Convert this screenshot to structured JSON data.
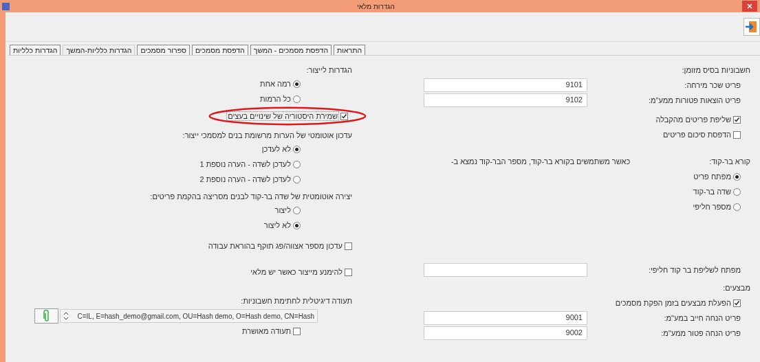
{
  "window": {
    "title": "הגדרות מלאי"
  },
  "tabs": [
    {
      "label": "התראות",
      "selected": false
    },
    {
      "label": "הדפסת מסמכים - המשך",
      "selected": false
    },
    {
      "label": "הדפסת מסמכים",
      "selected": false
    },
    {
      "label": "ספרור מסמכים",
      "selected": false
    },
    {
      "label": "הגדרות כלליות-המשך",
      "selected": true
    },
    {
      "label": "הגדרות כלליות",
      "selected": false
    }
  ],
  "cash_invoices": {
    "heading": "חשבוניות בסיס מזומן:",
    "fields": [
      {
        "label": "פריט שכר מירחה:",
        "value": "9101"
      },
      {
        "label": "פריט הוצאות פטורות ממע\"מ:",
        "value": "9102"
      }
    ],
    "checkboxes": [
      {
        "label": "שליפת פריטים מהקבלה",
        "checked": true
      },
      {
        "label": "הדפסת סיכום פריטים",
        "checked": false
      }
    ]
  },
  "barcode_reader": {
    "heading": "קורא בר-קוד:",
    "note": "כאשר משתמשים בקורא בר-קוד, מספר הבר-קוד נמצא ב-",
    "options": [
      {
        "label": "מפתח פריט",
        "selected": true
      },
      {
        "label": "שדה בר-קוד",
        "selected": false
      },
      {
        "label": "מספר חליפי",
        "selected": false
      }
    ]
  },
  "alt_barcode_key": {
    "label": "מפתח לשליפת בר קוד חליפי:"
  },
  "promotions": {
    "heading": "מבצעים:",
    "checkbox": {
      "label": "הפעלת מבצעים בזמן הפקת מסמכים",
      "checked": true
    },
    "fields": [
      {
        "label": "פריט הנחה חייב במע\"מ:",
        "value": "9001"
      },
      {
        "label": "פריט הנחה פטור ממע\"מ:",
        "value": "9002"
      }
    ]
  },
  "production": {
    "heading": "הגדרות לייצור:",
    "options": [
      {
        "label": "רמה אחת",
        "selected": true
      },
      {
        "label": "כל הרמות",
        "selected": false
      }
    ],
    "history_checkbox": {
      "label": "שמירת היסטוריה של שינויים בעצים",
      "checked": true
    }
  },
  "notes_update": {
    "heading": "עדכון אוטומטי של הערות מרשומת בנים למסמכי ייצור:",
    "options": [
      {
        "label": "לא לעדכן",
        "selected": true
      },
      {
        "label": "לעדכן לשדה - הערה נוספת 1",
        "selected": false
      },
      {
        "label": "לעדכן לשדה - הערה נוספת 2",
        "selected": false
      }
    ]
  },
  "barcode_creation": {
    "heading": "יצירה אוטומטית של שדה בר-קוד לבנים מסריצה בהקמת פריטים:",
    "options": [
      {
        "label": "ליצור",
        "selected": false
      },
      {
        "label": "לא ליצור",
        "selected": true
      }
    ]
  },
  "production_checkboxes": [
    {
      "label": "עדכון מספר אצווה/פג תוקף בהוראת עבודה",
      "checked": false
    },
    {
      "label": "להימנע מייצור כאשר יש מלאי",
      "checked": false
    }
  ],
  "certificate": {
    "heading": "תעודה דיגיטלית לחתימת חשבוניות:",
    "value": "C=IL, E=hash_demo@gmail.com, OU=Hash demo, O=Hash demo, CN=Hash",
    "approved": {
      "label": "תעודה מאושרת",
      "checked": false
    }
  }
}
